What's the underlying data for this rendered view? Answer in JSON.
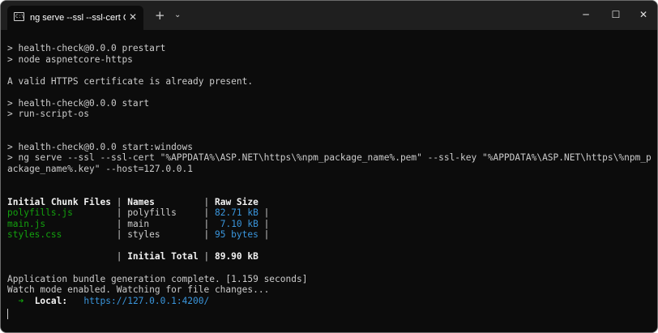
{
  "tab": {
    "title": "ng serve --ssl --ssl-cert C:\\Use",
    "close": "✕"
  },
  "titlebar": {
    "new_tab": "+",
    "dropdown": "⌄",
    "minimize": "─",
    "maximize": "☐",
    "close": "✕"
  },
  "terminal": {
    "l1": "> health-check@0.0.0 prestart",
    "l2": "> node aspnetcore-https",
    "l3": "A valid HTTPS certificate is already present.",
    "l4": "> health-check@0.0.0 start",
    "l5": "> run-script-os",
    "l6": "> health-check@0.0.0 start:windows",
    "l7": "> ng serve --ssl --ssl-cert \"%APPDATA%\\ASP.NET\\https\\%npm_package_name%.pem\" --ssl-key \"%APPDATA%\\ASP.NET\\https\\%npm_p",
    "l8": "ackage_name%.key\" --host=127.0.0.1",
    "table": {
      "header": {
        "files": "Initial Chunk Files",
        "sep": " | ",
        "names": "Names",
        "sep2": "         | ",
        "size": "Raw Size"
      },
      "rows": [
        {
          "file": "polyfills.js",
          "pad": "        | ",
          "name": "polyfills",
          "pad2": "     | ",
          "size": "82.71 kB",
          "end": " |"
        },
        {
          "file": "main.js",
          "pad": "             | ",
          "name": "main",
          "pad2": "          | ",
          "size": " 7.10 kB",
          "end": " |"
        },
        {
          "file": "styles.css",
          "pad": "          | ",
          "name": "styles",
          "pad2": "        | ",
          "size": "95 bytes",
          "end": " |"
        }
      ],
      "total": {
        "prefix": "                    | ",
        "label": "Initial Total",
        "sep": " | ",
        "value": "89.90 kB"
      }
    },
    "l9": "Application bundle generation complete. [1.159 seconds]",
    "l10": "Watch mode enabled. Watching for file changes...",
    "local": {
      "arrow": "  ➜",
      "label": "  Local:",
      "gap": "   ",
      "url": "https://127.0.0.1:4200/"
    }
  }
}
